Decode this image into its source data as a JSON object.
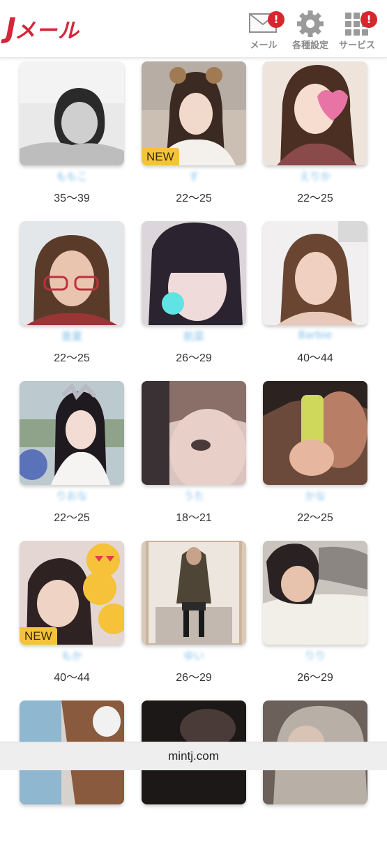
{
  "header": {
    "logo": {
      "first": "J",
      "rest": "メール"
    },
    "mail": {
      "label": "メール",
      "badge": "!"
    },
    "settings": {
      "label": "各種設定"
    },
    "services": {
      "label": "サービス",
      "badge": "!"
    }
  },
  "colors": {
    "brand": "#d3263a",
    "badge": "#d7262d",
    "new_tag": "#f3c43a",
    "name_text": "#7fbfe8"
  },
  "profiles": [
    {
      "name": "ももこ",
      "age": "35〜39",
      "new": false,
      "photo": "grayscale-portrait"
    },
    {
      "name": "す",
      "age": "22〜25",
      "new": true,
      "new_label": "NEW",
      "photo": "bear-ears-filter"
    },
    {
      "name": "えりか",
      "age": "22〜25",
      "new": false,
      "photo": "ng-sticker-portrait"
    },
    {
      "name": "亜夏",
      "age": "22〜25",
      "new": false,
      "photo": "red-glasses-portrait"
    },
    {
      "name": "航菜",
      "age": "26〜29",
      "new": false,
      "photo": "blurred-portrait"
    },
    {
      "name": "Barbie",
      "age": "40〜44",
      "new": false,
      "photo": "portrait"
    },
    {
      "name": "りおな",
      "age": "22〜25",
      "new": false,
      "photo": "theme-park-portrait"
    },
    {
      "name": "うた",
      "age": "18〜21",
      "new": false,
      "photo": "closeup-portrait"
    },
    {
      "name": "かな",
      "age": "22〜25",
      "new": false,
      "photo": "phone-selfie"
    },
    {
      "name": "もか",
      "age": "40〜44",
      "new": true,
      "new_label": "NEW",
      "photo": "emoji-stickers-portrait"
    },
    {
      "name": "ゆい",
      "age": "26〜29",
      "new": false,
      "photo": "mirror-selfie"
    },
    {
      "name": "りり",
      "age": "26〜29",
      "new": false,
      "photo": "lying-portrait"
    },
    {
      "name": "",
      "age": "",
      "new": false,
      "photo": "portrait"
    },
    {
      "name": "",
      "age": "",
      "new": false,
      "photo": "dark-portrait"
    },
    {
      "name": "",
      "age": "",
      "new": false,
      "photo": "portrait"
    }
  ],
  "footer": {
    "domain": "mintj.com"
  }
}
